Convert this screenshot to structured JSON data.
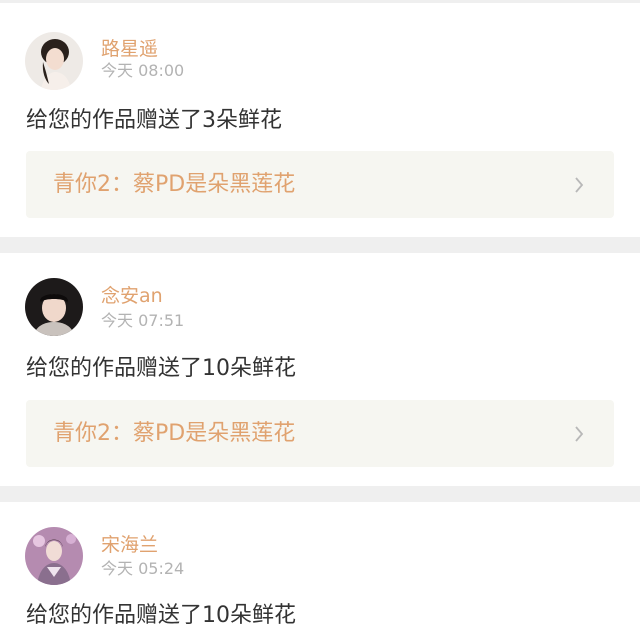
{
  "notifications": [
    {
      "avatar_icon": "girl-portrait-avatar-icon",
      "username": "路星遥",
      "time": "今天 08:00",
      "message": "给您的作品赠送了3朵鲜花",
      "work_title": "青你2：蔡PD是朵黑莲花"
    },
    {
      "avatar_icon": "girl-with-bangs-avatar-icon",
      "username": "念安an",
      "time": "今天 07:51",
      "message": "给您的作品赠送了10朵鲜花",
      "work_title": "青你2：蔡PD是朵黑莲花"
    },
    {
      "avatar_icon": "performer-on-stage-avatar-icon",
      "username": "宋海兰",
      "time": "今天 05:24",
      "message": "给您的作品赠送了10朵鲜花"
    }
  ],
  "colors": {
    "accent": "#e0a26f",
    "time_gray": "#b3b3b3",
    "text": "#333333",
    "link_background": "#f6f6f1",
    "separator": "#efefef"
  }
}
